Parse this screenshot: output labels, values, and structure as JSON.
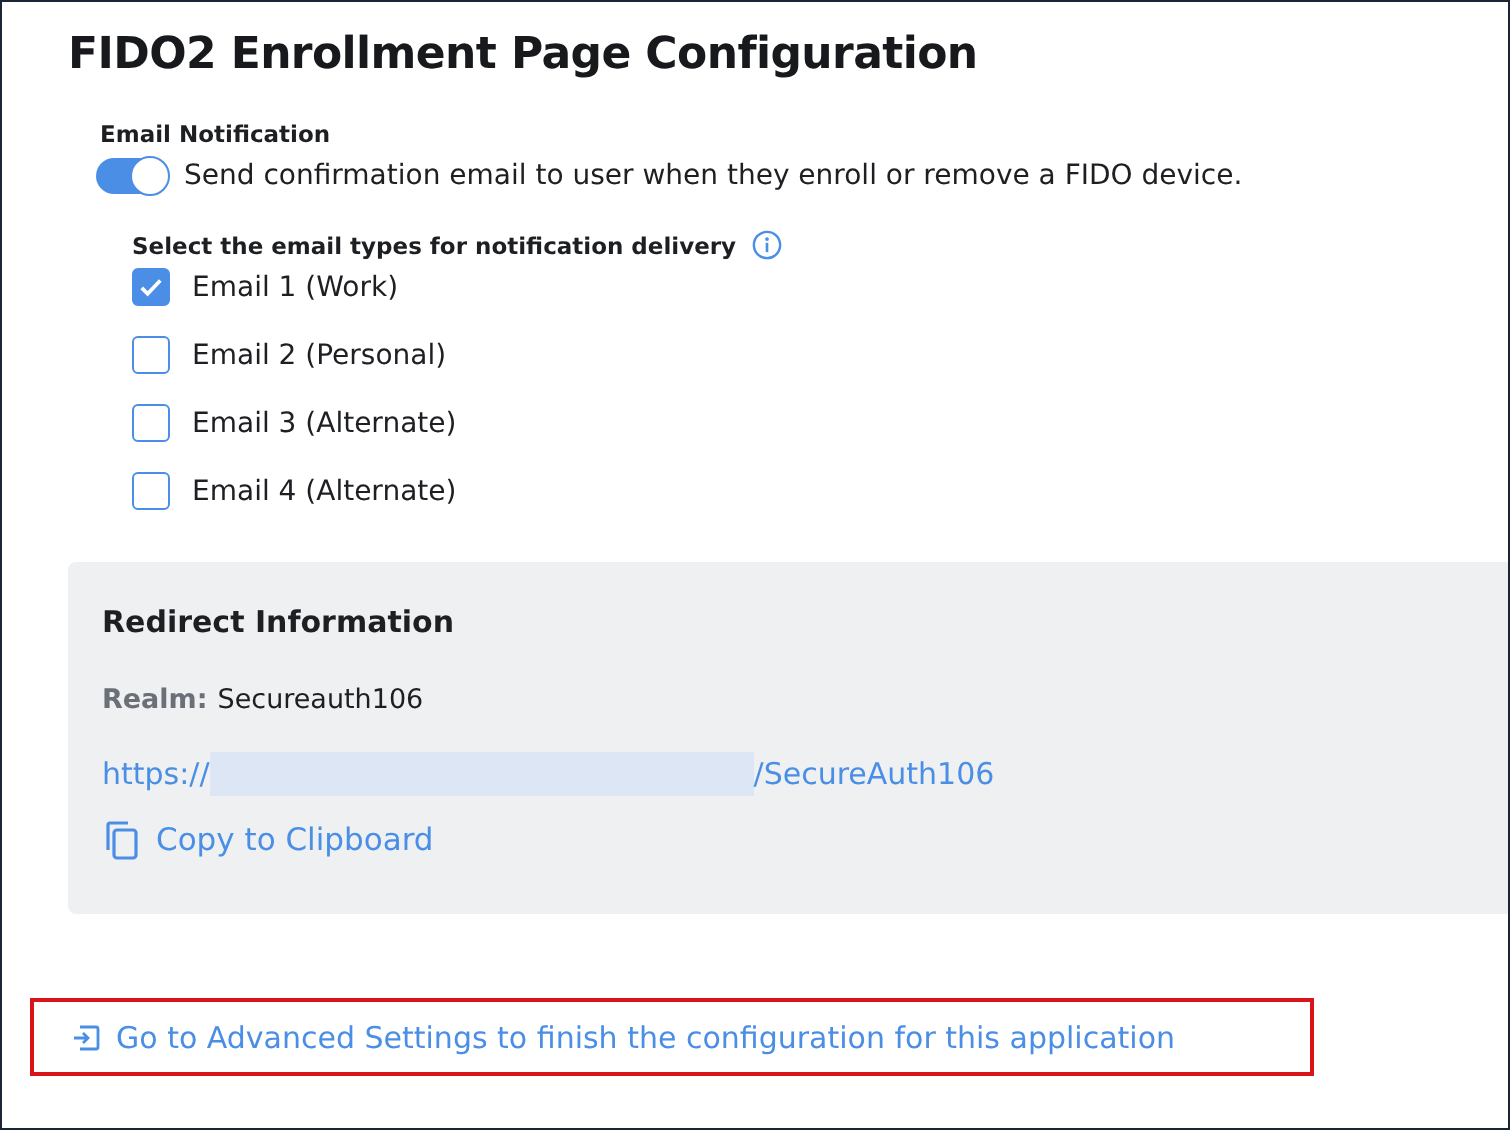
{
  "page": {
    "title": "FIDO2 Enrollment Page Configuration"
  },
  "email_notification": {
    "label": "Email Notification",
    "toggle": {
      "on": true,
      "label": "Send confirmation email to user when they enroll or remove a FIDO device."
    }
  },
  "email_types": {
    "heading": "Select the email types for notification delivery",
    "options": [
      {
        "label": "Email 1 (Work)",
        "checked": true
      },
      {
        "label": "Email 2 (Personal)",
        "checked": false
      },
      {
        "label": "Email 3 (Alternate)",
        "checked": false
      },
      {
        "label": "Email 4 (Alternate)",
        "checked": false
      }
    ]
  },
  "redirect": {
    "title": "Redirect Information",
    "realm_label": "Realm:",
    "realm_value": "Secureauth106",
    "url_prefix": "https://",
    "url_suffix": "/SecureAuth106",
    "copy_label": "Copy to Clipboard"
  },
  "advanced_link": {
    "label": "Go to Advanced Settings to finish the configuration for this application",
    "highlighted": true
  }
}
